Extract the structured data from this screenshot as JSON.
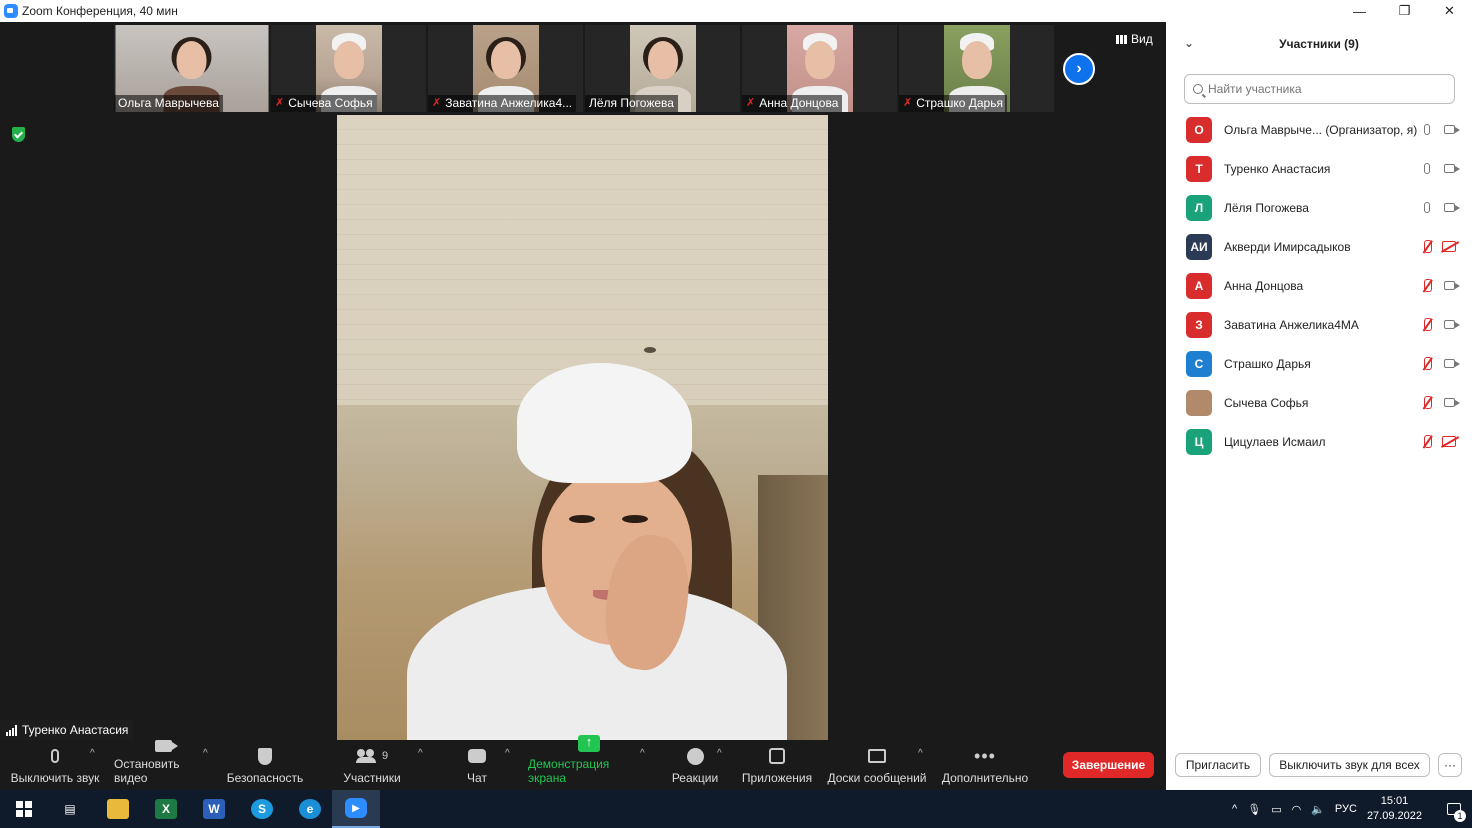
{
  "window": {
    "title": "Zoom Конференция, 40 мин",
    "controls": [
      "—",
      "❐",
      "✕"
    ]
  },
  "video": {
    "view_label": "Вид",
    "thumbnails": [
      {
        "name": "Ольга Маврычева",
        "muted": false
      },
      {
        "name": "Сычева Софья",
        "muted": true
      },
      {
        "name": "Заватина Анжелика4...",
        "muted": true
      },
      {
        "name": "Лёля Погожева",
        "muted": false
      },
      {
        "name": "Анна Донцова",
        "muted": true
      },
      {
        "name": "Страшко Дарья",
        "muted": true
      }
    ],
    "active_speaker": "Туренко Анастасия"
  },
  "toolbar": {
    "mute": "Выключить звук",
    "stop_video": "Остановить видео",
    "security": "Безопасность",
    "participants": "Участники",
    "participants_count": "9",
    "chat": "Чат",
    "share": "Демонстрация экрана",
    "reactions": "Реакции",
    "apps": "Приложения",
    "whiteboards": "Доски сообщений",
    "more": "Дополнительно",
    "end": "Завершение"
  },
  "panel": {
    "title": "Участники (9)",
    "search_placeholder": "Найти участника",
    "participants": [
      {
        "initials": "О",
        "name": "Ольга Маврыче...  (Организатор, я)",
        "color": "#d92c2c",
        "mic": "on",
        "cam": "on"
      },
      {
        "initials": "Т",
        "name": "Туренко Анастасия",
        "color": "#d92c2c",
        "mic": "on",
        "cam": "on"
      },
      {
        "initials": "Л",
        "name": "Лёля Погожева",
        "color": "#1aa37a",
        "mic": "on",
        "cam": "on"
      },
      {
        "initials": "АИ",
        "name": "Акверди Имирсадыков",
        "color": "#2b3a55",
        "mic": "off",
        "cam": "off"
      },
      {
        "initials": "А",
        "name": "Анна Донцова",
        "color": "#d92c2c",
        "mic": "off",
        "cam": "on"
      },
      {
        "initials": "З",
        "name": "Заватина Анжелика4МА",
        "color": "#d92c2c",
        "mic": "off",
        "cam": "on"
      },
      {
        "initials": "С",
        "name": "Страшко Дарья",
        "color": "#1e7fd0",
        "mic": "off",
        "cam": "on"
      },
      {
        "initials": "",
        "name": "Сычева Софья",
        "color": "#b08a6a",
        "mic": "off",
        "cam": "on"
      },
      {
        "initials": "Ц",
        "name": "Цицулаев Исмаил",
        "color": "#1aa37a",
        "mic": "off",
        "cam": "off"
      }
    ],
    "invite": "Пригласить",
    "mute_all": "Выключить звук для всех",
    "more": "···"
  },
  "taskbar": {
    "apps": [
      {
        "label": "⊞",
        "color": "transparent"
      },
      {
        "label": "▤",
        "color": "transparent"
      },
      {
        "label": "",
        "color": "#e8b93a"
      },
      {
        "label": "X",
        "color": "#1d7a45"
      },
      {
        "label": "W",
        "color": "#2b5fb8"
      },
      {
        "label": "S",
        "color": "#1c9be0"
      },
      {
        "label": "e",
        "color": "#1a8fd8"
      },
      {
        "label": "▶",
        "color": "#2d8cff"
      }
    ],
    "lang": "РУС",
    "time": "15:01",
    "date": "27.09.2022",
    "notifications": "1"
  }
}
